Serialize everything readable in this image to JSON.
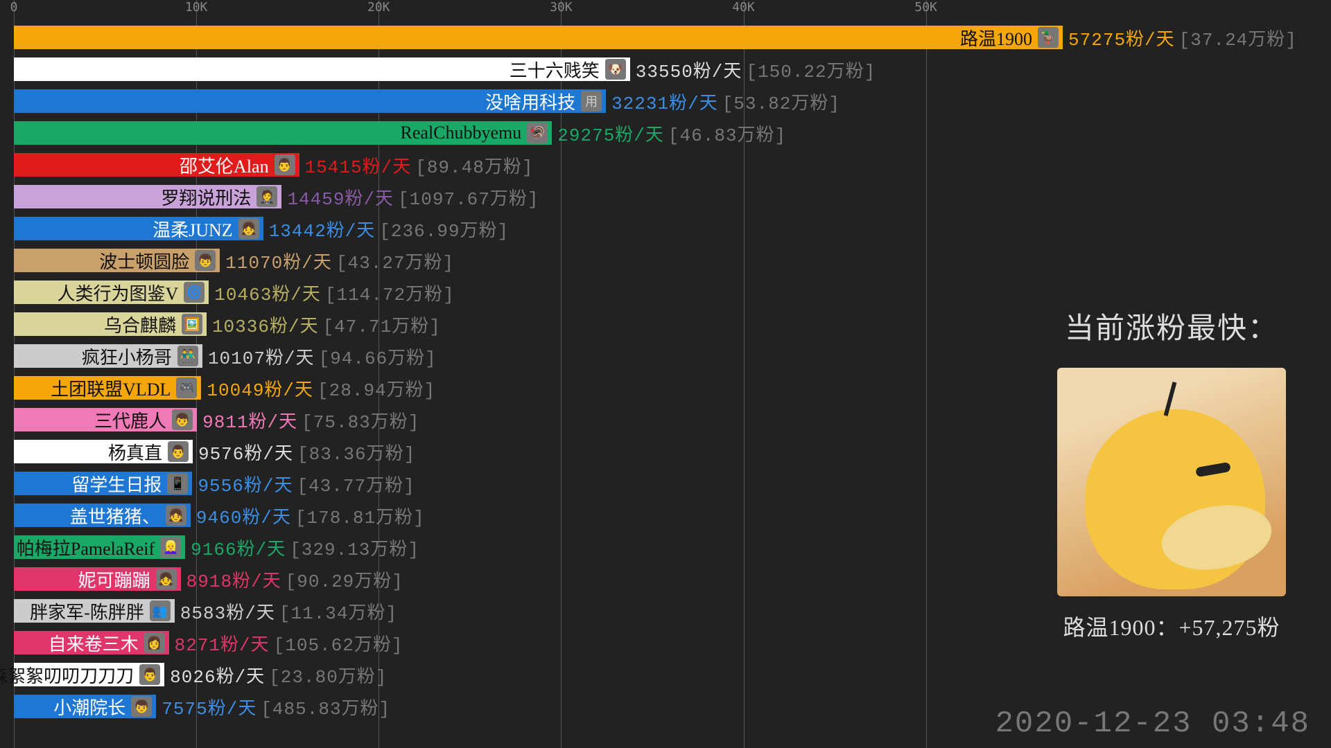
{
  "chart_data": {
    "type": "bar",
    "orientation": "horizontal",
    "xlabel": "",
    "ylabel": "",
    "x_ticks": [
      0,
      10000,
      20000,
      30000,
      40000,
      50000
    ],
    "x_tick_labels": [
      "0",
      "10K",
      "20K",
      "30K",
      "40K",
      "50K"
    ],
    "value_unit": "粉/天",
    "total_unit": "万粉",
    "series": [
      {
        "name": "路温1900",
        "value": 57275,
        "total": 37.24,
        "bar_color": "#f5a70a",
        "text_color": "#f5a70a",
        "avatar_emoji": "🦆"
      },
      {
        "name": "三十六贱笑",
        "value": 33550,
        "total": 150.22,
        "bar_color": "#ffffff",
        "text_color": "#dddddd",
        "avatar_emoji": "🐶"
      },
      {
        "name": "没啥用科技",
        "value": 32231,
        "total": 53.82,
        "bar_color": "#1f77d4",
        "text_color": "#3b8ee6",
        "avatar_emoji": "用"
      },
      {
        "name": "RealChubbyemu",
        "value": 29275,
        "total": 46.83,
        "bar_color": "#1aa867",
        "text_color": "#1aa867",
        "avatar_emoji": "🦃"
      },
      {
        "name": "邵艾伦Alan",
        "value": 15415,
        "total": 89.48,
        "bar_color": "#e11b1b",
        "text_color": "#e11b1b",
        "avatar_emoji": "👨"
      },
      {
        "name": "罗翔说刑法",
        "value": 14459,
        "total": 1097.67,
        "bar_color": "#c8a2d8",
        "text_color": "#8a5aa8",
        "avatar_emoji": "🤵"
      },
      {
        "name": "温柔JUNZ",
        "value": 13442,
        "total": 236.99,
        "bar_color": "#1f77d4",
        "text_color": "#3b8ee6",
        "avatar_emoji": "👧"
      },
      {
        "name": "波士顿圆脸",
        "value": 11070,
        "total": 43.27,
        "bar_color": "#c9a06a",
        "text_color": "#c9a06a",
        "avatar_emoji": "👦"
      },
      {
        "name": "人类行为图鉴V",
        "value": 10463,
        "total": 114.72,
        "bar_color": "#d8d49a",
        "text_color": "#b8b060",
        "avatar_emoji": "🌀"
      },
      {
        "name": "乌合麒麟",
        "value": 10336,
        "total": 47.71,
        "bar_color": "#d8d49a",
        "text_color": "#b8b060",
        "avatar_emoji": "🖼️"
      },
      {
        "name": "疯狂小杨哥",
        "value": 10107,
        "total": 94.66,
        "bar_color": "#cccccc",
        "text_color": "#cccccc",
        "avatar_emoji": "👬"
      },
      {
        "name": "土团联盟VLDL",
        "value": 10049,
        "total": 28.94,
        "bar_color": "#f5a70a",
        "text_color": "#f5a70a",
        "avatar_emoji": "🎮"
      },
      {
        "name": "三代鹿人",
        "value": 9811,
        "total": 75.83,
        "bar_color": "#f07ab8",
        "text_color": "#f07ab8",
        "avatar_emoji": "👦"
      },
      {
        "name": "杨真直",
        "value": 9576,
        "total": 83.36,
        "bar_color": "#ffffff",
        "text_color": "#dddddd",
        "avatar_emoji": "👨"
      },
      {
        "name": "留学生日报",
        "value": 9556,
        "total": 43.77,
        "bar_color": "#1f77d4",
        "text_color": "#3b8ee6",
        "avatar_emoji": "📱"
      },
      {
        "name": "盖世猪猪、",
        "value": 9460,
        "total": 178.81,
        "bar_color": "#1f77d4",
        "text_color": "#3b8ee6",
        "avatar_emoji": "👧"
      },
      {
        "name": "帕梅拉PamelaReif",
        "value": 9166,
        "total": 329.13,
        "bar_color": "#1aa867",
        "text_color": "#1aa867",
        "avatar_emoji": "👱‍♀️"
      },
      {
        "name": "妮可蹦蹦",
        "value": 8918,
        "total": 90.29,
        "bar_color": "#e0356a",
        "text_color": "#e0356a",
        "avatar_emoji": "👧"
      },
      {
        "name": "胖家军-陈胖胖",
        "value": 8583,
        "total": 11.34,
        "bar_color": "#cccccc",
        "text_color": "#cccccc",
        "avatar_emoji": "👥"
      },
      {
        "name": "自来卷三木",
        "value": 8271,
        "total": 105.62,
        "bar_color": "#e0356a",
        "text_color": "#e0356a",
        "avatar_emoji": "👩"
      },
      {
        "name": "丁克森絮絮叨叨刀刀刀",
        "value": 8026,
        "total": 23.8,
        "bar_color": "#ffffff",
        "text_color": "#dddddd",
        "avatar_emoji": "👨"
      },
      {
        "name": "小潮院长",
        "value": 7575,
        "total": 485.83,
        "bar_color": "#1f77d4",
        "text_color": "#3b8ee6",
        "avatar_emoji": "👦"
      }
    ]
  },
  "side_panel": {
    "title": "当前涨粉最快：",
    "caption_name": "路温1900",
    "caption_value": "+57,275粉"
  },
  "timestamp": "2020-12-23 03:48"
}
